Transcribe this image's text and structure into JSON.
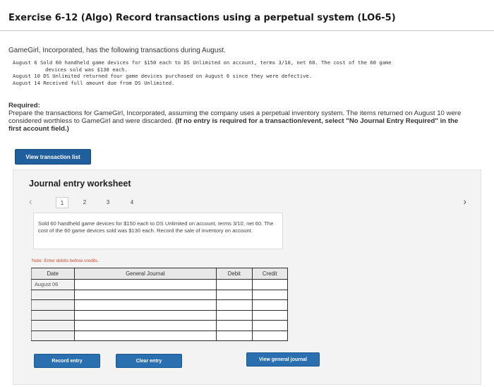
{
  "header": {
    "title": "Exercise 6-12 (Algo) Record transactions using a perpetual system (LO6-5)"
  },
  "intro": "GameGirl, Incorporated, has the following transactions during August.",
  "transactions": [
    {
      "line": "August  6  Sold 60 handheld game devices for $150 each to DS Unlimited on account, terms 3/10, net 60. The cost of the 60 game"
    },
    {
      "line": "devices sold was $130 each.",
      "indent": true
    },
    {
      "line": "August  10 DS Unlimited returned four game devices purchased on August 6 since they were defective."
    },
    {
      "line": "August  14 Received full amount due from DS Unlimited."
    }
  ],
  "required": {
    "label": "Required:",
    "text": "Prepare the transactions for GameGirl, Incorporated, assuming the company uses a perpetual inventory system. The items returned on August 10 were considered worthless to GameGirl and were discarded.",
    "bold_text": "(If no entry is required for a transaction/event, select \"No Journal Entry Required\" in the first account field.)"
  },
  "buttons": {
    "view_transaction_list": "View transaction list",
    "record_entry": "Record entry",
    "clear_entry": "Clear entry",
    "view_general_journal": "View general journal"
  },
  "worksheet": {
    "title": "Journal entry worksheet",
    "pages": [
      "1",
      "2",
      "3",
      "4"
    ],
    "active_page": "1",
    "description": "Sold 60 handheld game devices for $150 each to DS Unlimited on account, terms 3/10, net 60. The cost of the 60 game devices sold was $130 each. Record the sale of inventory on account.",
    "note": "Note: Enter debits before credits.",
    "columns": {
      "date": "Date",
      "general_journal": "General Journal",
      "debit": "Debit",
      "credit": "Credit"
    },
    "rows": [
      {
        "date": "August 06",
        "account": "",
        "debit": "",
        "credit": ""
      },
      {
        "date": "",
        "account": "",
        "debit": "",
        "credit": ""
      },
      {
        "date": "",
        "account": "",
        "debit": "",
        "credit": ""
      },
      {
        "date": "",
        "account": "",
        "debit": "",
        "credit": ""
      },
      {
        "date": "",
        "account": "",
        "debit": "",
        "credit": ""
      },
      {
        "date": "",
        "account": "",
        "debit": "",
        "credit": ""
      }
    ]
  },
  "colors": {
    "button_blue": "#2a6fb0",
    "note_red": "#d04a2a"
  },
  "icons": {
    "prev": "chevron-left-icon",
    "next": "chevron-right-icon"
  }
}
